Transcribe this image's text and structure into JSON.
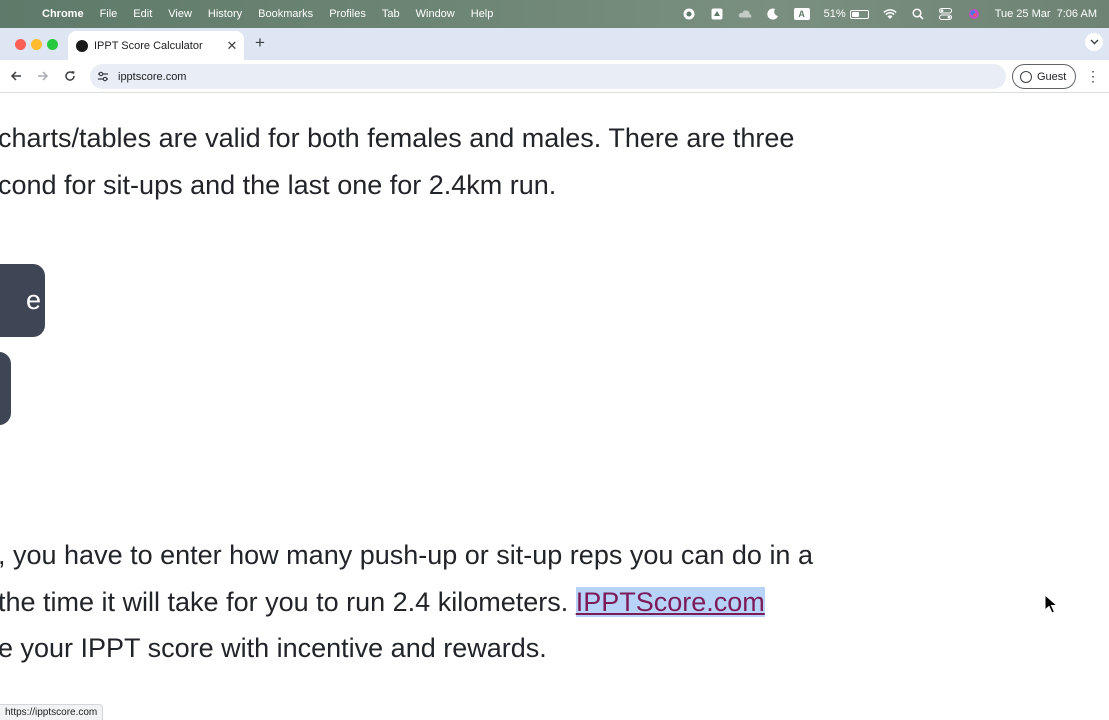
{
  "menubar": {
    "app_name": "Chrome",
    "menus": [
      "File",
      "Edit",
      "View",
      "History",
      "Bookmarks",
      "Profiles",
      "Tab",
      "Window",
      "Help"
    ],
    "battery_percent": "51%",
    "battery_level": 0.51,
    "datetime": "Tue 25 Mar  7:06 AM",
    "input_source": "A"
  },
  "browser": {
    "tab_title": "IPPT Score Calculator",
    "url": "ipptscore.com",
    "profile_label": "Guest"
  },
  "page": {
    "para1_line1": "charts/tables are valid for both females and males. There are three",
    "para1_line2": "cond for sit-ups and the last one for 2.4km run.",
    "button1_label": "e",
    "para2_line1": ", you have to enter how many push-up or sit-up reps you can do in a",
    "para2_line2_prefix": "the time it will take for you to run 2.4 kilometers. ",
    "para2_link": "IPPTScore.com",
    "para2_line3": "e your IPPT score with incentive and rewards."
  },
  "status_bar": {
    "hover_url": "https://ipptscore.com"
  },
  "colors": {
    "accent_button": "#3e4554",
    "link": "#7d1b5a",
    "selection": "#b7d3f7"
  }
}
